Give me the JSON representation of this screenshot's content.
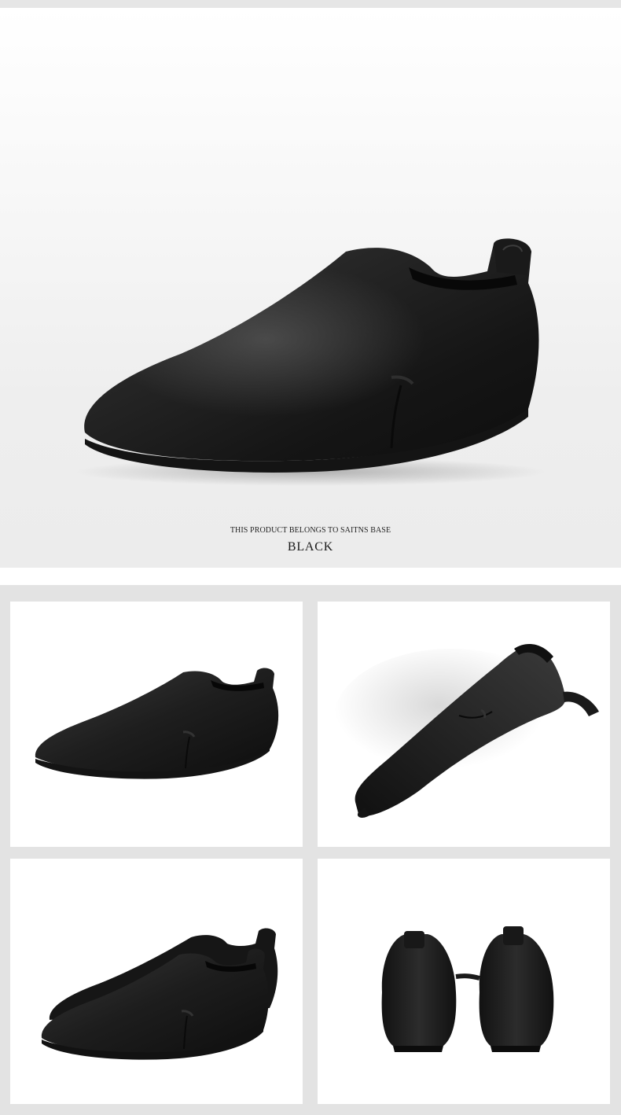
{
  "hero": {
    "caption": "THIS PRODUCT BELONGS TO SAITNS BASE",
    "color_name": "BLACK"
  },
  "gallery": [
    {
      "view": "side-view-shoe"
    },
    {
      "view": "top-angled-shoe"
    },
    {
      "view": "pair-side-view"
    },
    {
      "view": "pair-heel-view"
    }
  ],
  "colors": {
    "leather": "#1c1c1c",
    "leather_highlight": "#5a5a5a",
    "sole": "#141414",
    "hero_background": "#eeeeee",
    "grid_background": "#e3e3e3"
  }
}
